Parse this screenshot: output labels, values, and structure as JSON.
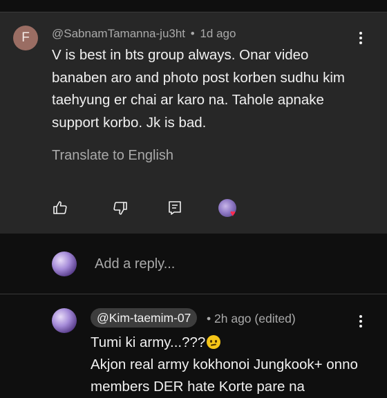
{
  "comment": {
    "avatar_letter": "F",
    "author": "@SabnamTamanna-ju3ht",
    "separator": "•",
    "time": "1d ago",
    "text": "V is best in bts group always. Onar video banaben aro and photo post korben sudhu kim taehyung er chai ar karo na. Tahole apnake support korbo. Jk is bad.",
    "translate_label": "Translate to English",
    "actions": {
      "like_icon": "thumb-up-icon",
      "dislike_icon": "thumb-down-icon",
      "reply_icon": "comment-icon",
      "creator_heart_icon": "creator-heart-icon"
    }
  },
  "reply_box": {
    "placeholder": "Add a reply..."
  },
  "reply": {
    "mention": "@Kim-taemim-07",
    "separator": "•",
    "time": "2h ago (edited)",
    "line1": "Tumi ki army...???",
    "emoji_icon": "worried-face-icon",
    "line2": "Akjon real army kokhonoi Jungkook+ onno members DER hate Korte pare na"
  },
  "colors": {
    "background": "#0f0f0f",
    "card": "#272727",
    "secondary_text": "#aaaaaa",
    "heart": "#ff2a4f"
  }
}
